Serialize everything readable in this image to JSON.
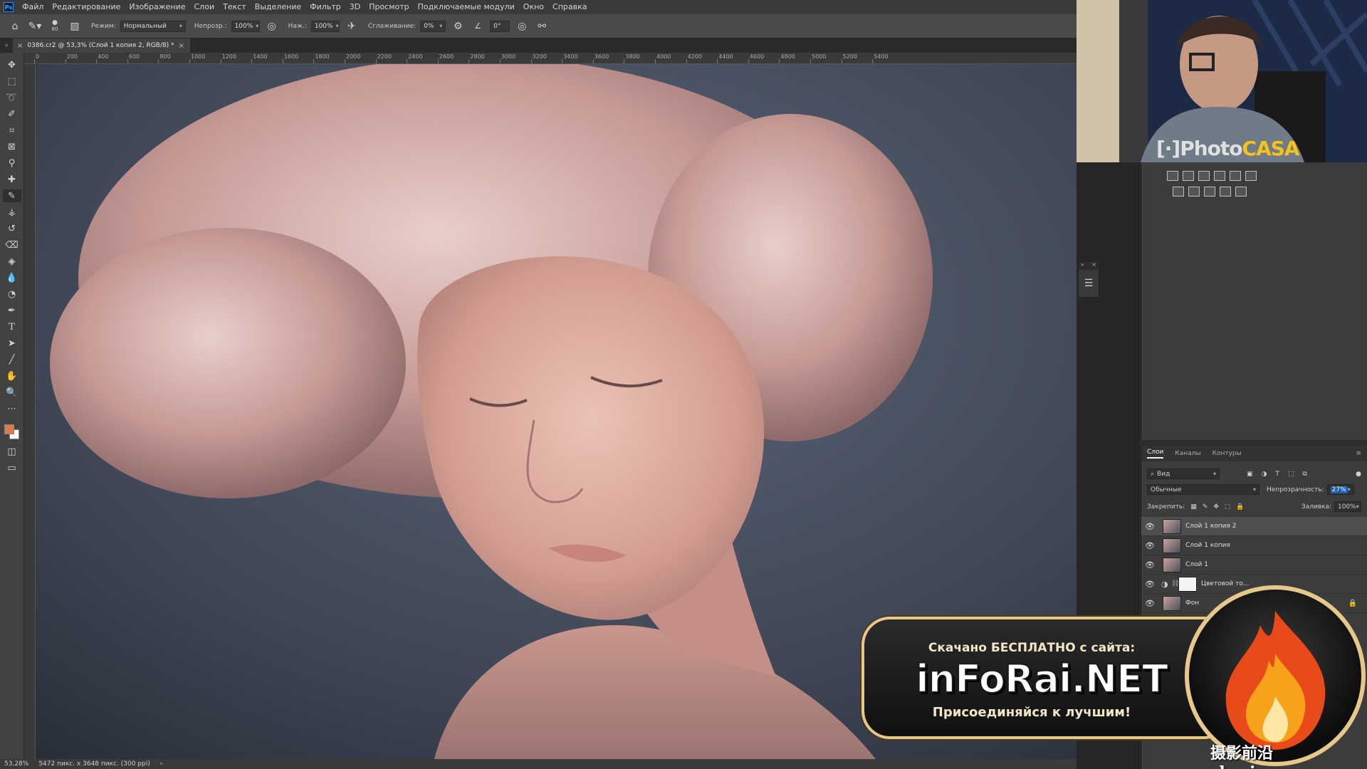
{
  "menu": [
    "Файл",
    "Редактирование",
    "Изображение",
    "Слои",
    "Текст",
    "Выделение",
    "Фильтр",
    "3D",
    "Просмотр",
    "Подключаемые модули",
    "Окно",
    "Справка"
  ],
  "options": {
    "brush_size": "80",
    "mode_label": "Режим:",
    "mode_value": "Нормальный",
    "opacity_label": "Непрозр.:",
    "opacity_value": "100%",
    "flow_label": "Наж.:",
    "flow_value": "100%",
    "smoothing_label": "Сглаживание:",
    "smoothing_value": "0%",
    "angle_value": "0°"
  },
  "document": {
    "tab_title": "0386.cr2 @ 53,3% (Слой 1 копия 2, RGB/8) *",
    "zoom": "53,28%",
    "dims": "5472 пикс. x 3648 пикс. (300 ppi)"
  },
  "ruler_top_labels": [
    "0",
    "200",
    "400",
    "600",
    "800",
    "1000",
    "1200",
    "1400",
    "1600",
    "1800",
    "2000",
    "2200",
    "2400",
    "2600",
    "2800",
    "3000",
    "3200",
    "3400",
    "3600",
    "3800",
    "4000",
    "4200",
    "4400",
    "4600",
    "4800",
    "5000",
    "5200",
    "5400"
  ],
  "layers": {
    "tabs": [
      "Слои",
      "Каналы",
      "Контуры"
    ],
    "filter_kind": "Вид",
    "blend_mode": "Обычные",
    "opacity_label": "Непрозрачность:",
    "opacity_value": "27%",
    "lock_label": "Закрепить:",
    "fill_label": "Заливка:",
    "fill_value": "100%",
    "items": [
      {
        "name": "Слой 1 копия 2",
        "selected": true
      },
      {
        "name": "Слой 1 копия",
        "selected": false
      },
      {
        "name": "Слой 1",
        "selected": false
      },
      {
        "name": "Цветовой то...",
        "selected": false
      },
      {
        "name": "Фон",
        "selected": false
      }
    ]
  },
  "webcam": {
    "logo_prefix": "[·]Photo",
    "logo_suffix": "CASA"
  },
  "promo": {
    "line1": "Скачано БЕСПЛАТНО с сайта:",
    "big": "inFoRai.NET",
    "line3": "Присоединяйся к лучшим!"
  },
  "watermark_bottom": "摄影前沿 sheyingzyz.com",
  "colors": {
    "foreground": "#d87a4a",
    "background": "#ffffff",
    "accent_gold": "#e6c98a",
    "casa_yellow": "#f7c21a"
  }
}
